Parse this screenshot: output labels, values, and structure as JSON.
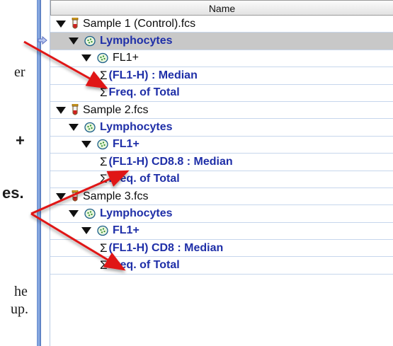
{
  "side_text": [
    {
      "text": "er",
      "style": "serif"
    },
    {
      "text": "+",
      "style": "bold"
    },
    {
      "text": "es.",
      "style": "bold"
    },
    {
      "text": "he",
      "style": "serif"
    },
    {
      "text": "up.",
      "style": "serif"
    }
  ],
  "workspace": {
    "column_header": "Name",
    "rows": [
      {
        "type": "sample",
        "label": "Sample 1 (Control).fcs"
      },
      {
        "type": "gate",
        "label": "Lymphocytes",
        "selected": true
      },
      {
        "type": "gate",
        "label": "FL1+"
      },
      {
        "type": "stat",
        "label": "(FL1-H)  : Median"
      },
      {
        "type": "stat",
        "label": "Freq. of Total"
      },
      {
        "type": "sample",
        "label": "Sample 2.fcs"
      },
      {
        "type": "gate",
        "label": "Lymphocytes"
      },
      {
        "type": "gate",
        "label": "FL1+"
      },
      {
        "type": "stat",
        "label": "(FL1-H) CD8.8 : Median"
      },
      {
        "type": "stat",
        "label": "Freq. of Total"
      },
      {
        "type": "sample",
        "label": "Sample 3.fcs"
      },
      {
        "type": "gate",
        "label": "Lymphocytes"
      },
      {
        "type": "gate",
        "label": "FL1+"
      },
      {
        "type": "stat",
        "label": "(FL1-H) CD8 : Median"
      },
      {
        "type": "stat",
        "label": "Freq. of Total"
      }
    ]
  },
  "icons": {
    "expand": "triangle-down-icon",
    "sample": "test-tube-icon",
    "gate": "gate-cells-icon",
    "statistic": "sigma-icon",
    "selection_marker": "arrow-marker-icon",
    "annotation": "red-arrow-icon"
  },
  "colors": {
    "window_border": "#4a6fb7",
    "row_divider": "#c6d6ec",
    "selected_row": "#c8c8c8",
    "bold_link": "#1f2fa8",
    "annotation_arrow": "#e01818",
    "tube_cap": "#d8a21e"
  }
}
